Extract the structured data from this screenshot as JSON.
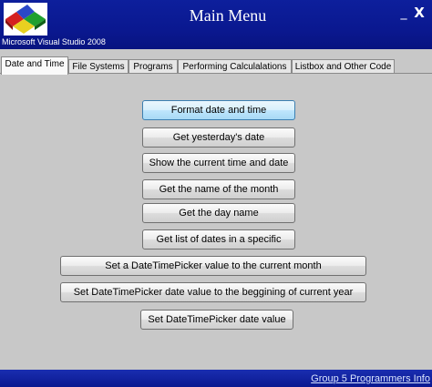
{
  "window": {
    "title": "Main Menu",
    "logo_caption": "Microsoft Visual Studio 2008",
    "minimize_label": "_",
    "close_label": "X"
  },
  "tabs": [
    {
      "label": "Date and Time",
      "active": true
    },
    {
      "label": "File Systems",
      "active": false
    },
    {
      "label": "Programs",
      "active": false
    },
    {
      "label": "Performing Calculalations",
      "active": false
    },
    {
      "label": "Listbox and Other Code",
      "active": false
    }
  ],
  "buttons": [
    {
      "label": "Format date and time"
    },
    {
      "label": "Get yesterday's date"
    },
    {
      "label": "Show the current time and date"
    },
    {
      "label": "Get the name of the month"
    },
    {
      "label": "Get the day name"
    },
    {
      "label": "Get list of dates in a specific"
    },
    {
      "label": "Set a DateTimePicker value to the current month"
    },
    {
      "label": "Set DateTimePicker date value to the beggining of current year"
    },
    {
      "label": "Set DateTimePicker date value"
    }
  ],
  "status": {
    "link_text": "Group 5 Programmers Info"
  }
}
